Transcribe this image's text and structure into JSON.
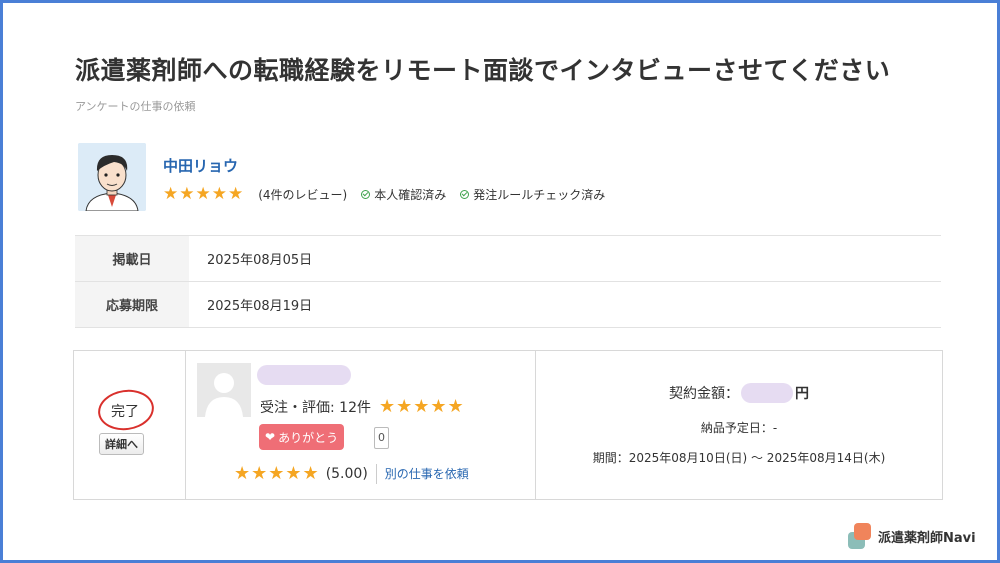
{
  "title": "派遣薬剤師への転職経験をリモート面談でインタビューさせてください",
  "subtitle": "アンケートの仕事の依頼",
  "client": {
    "name": "中田リョウ",
    "stars": "★★★★★",
    "review_count": "(4件のレビュー)",
    "badges": [
      "本人確認済み",
      "発注ルールチェック済み"
    ]
  },
  "info_rows": [
    {
      "label": "掲載日",
      "value": "2025年08月05日"
    },
    {
      "label": "応募期限",
      "value": "2025年08月19日"
    }
  ],
  "entry": {
    "status": "完了",
    "detail_button": "詳細へ",
    "orders_label": "受注・評価: 12件",
    "orders_stars": "★★★★★",
    "thanks_button": "ありがとう",
    "thanks_count": "0",
    "rating_stars": "★★★★★",
    "rating_value": "(5.00)",
    "request_link": "別の仕事を依頼",
    "contract_label": "契約金額：",
    "contract_unit": "円",
    "due_date": "納品予定日：-",
    "period": "期間：2025年08月10日(日) 〜 2025年08月14日(木)"
  },
  "brand": "派遣薬剤師Navi",
  "colors": {
    "frame": "#4a7fd6",
    "star": "#f5a623",
    "link": "#2766b0",
    "thanks": "#ef6e76",
    "done_circle": "#d9302c"
  }
}
